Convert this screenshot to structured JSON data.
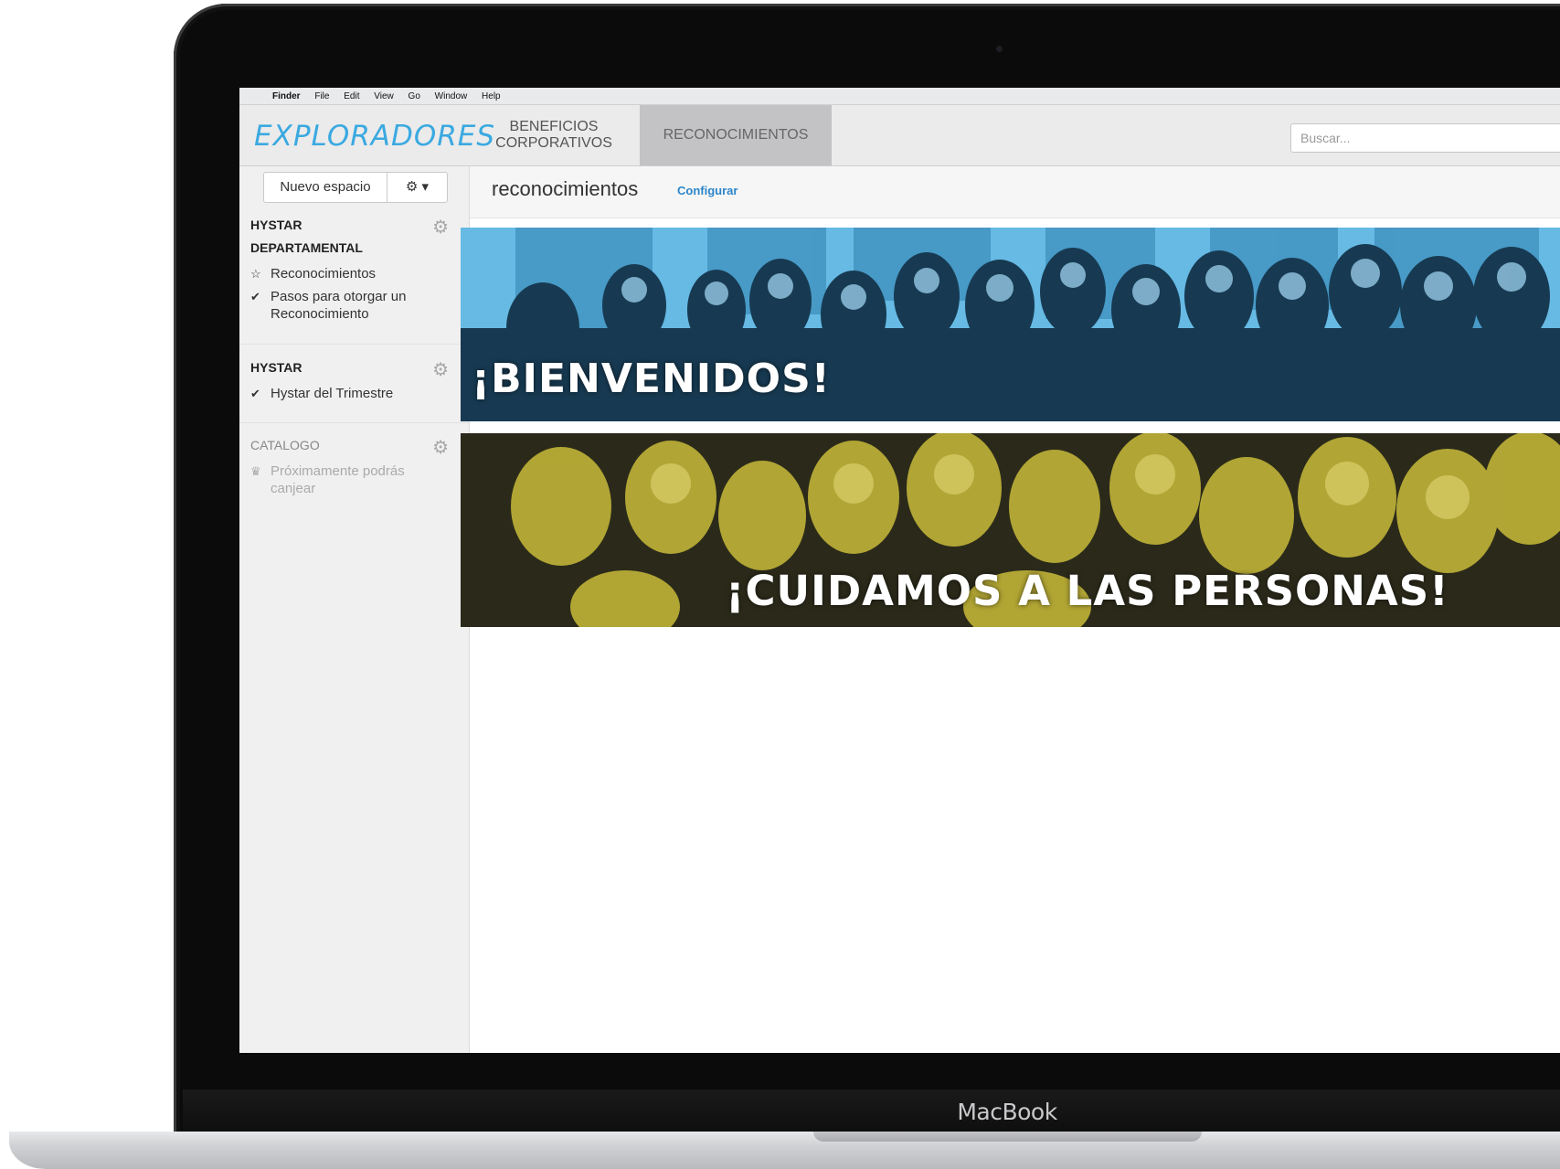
{
  "menubar": {
    "apple": "",
    "items": [
      "Finder",
      "File",
      "Edit",
      "View",
      "Go",
      "Window",
      "Help"
    ]
  },
  "logo": {
    "text": "EXPLORADORES"
  },
  "nav": {
    "tab1": "BENEFICIOS\nCORPORATIVOS",
    "tab1_line1": "BENEFICIOS",
    "tab1_line2": "CORPORATIVOS",
    "tab2": "RECONOCIMIENTOS"
  },
  "search": {
    "placeholder": "Buscar..."
  },
  "sidebar": {
    "new_space": "Nuevo espacio",
    "gear_dropdown": "⚙ ▾",
    "sections": [
      {
        "title": "HYSTAR DEPARTAMENTAL",
        "items": [
          {
            "icon": "☆",
            "label": "Reconocimientos"
          },
          {
            "icon": "✔",
            "label": "Pasos para otorgar un Reconocimiento"
          }
        ]
      },
      {
        "title": "HYSTAR",
        "items": [
          {
            "icon": "✔",
            "label": "Hystar del Trimestre"
          }
        ]
      },
      {
        "title": "CATALOGO",
        "items": [
          {
            "icon": "♛",
            "label": "Próximamente podrás canjear"
          }
        ]
      }
    ],
    "gear_icon": "⚙"
  },
  "main": {
    "title": "reconocimientos",
    "config_link": "Configurar"
  },
  "banners": [
    {
      "text": "¡BIENVENIDOS!",
      "tint": "#4aa6d6"
    },
    {
      "text": "¡CUIDAMOS A LAS PERSONAS!",
      "tint": "#c9bb3a"
    }
  ],
  "device": {
    "label": "MacBook"
  }
}
